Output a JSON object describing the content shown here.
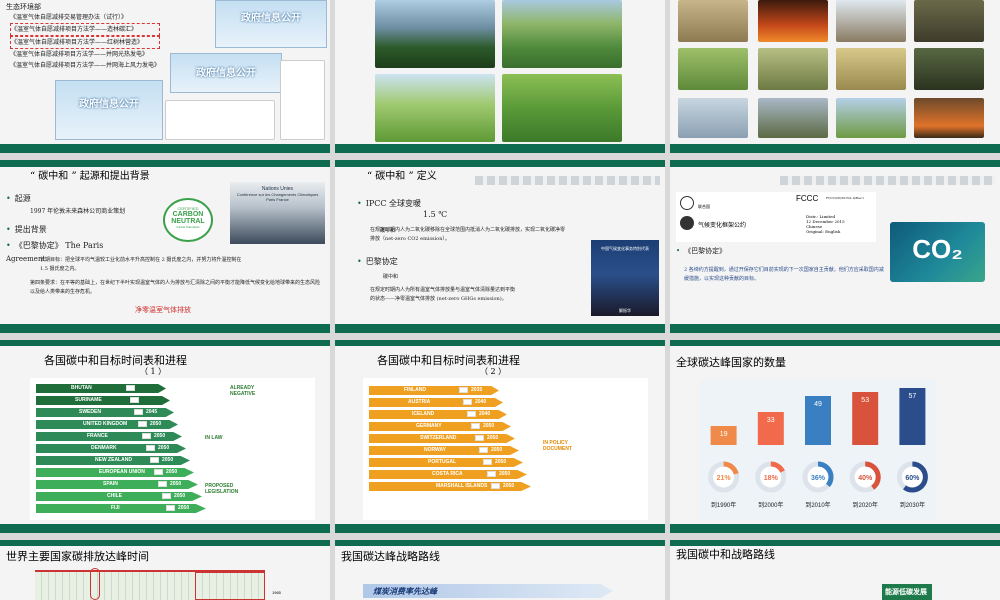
{
  "slide1": {
    "org": "生态环境部",
    "lines": [
      "《温室气体自愿减排交易管理办法（试行）》",
      "《温室气体自愿减排项目方法学——造林碳汇》",
      "《温室气体自愿减排项目方法学——红树林营造》",
      "《温室气体自愿减排项目方法学——并网光热发电》",
      "《温室气体自愿减排项目方法学——并网海上风力发电》"
    ],
    "gov_label": "政府信息公开"
  },
  "slide4": {
    "title": "“ 碳中和 ” 起源和提出背景",
    "title_tail": "景",
    "b1": "起源",
    "b1_sub": "1997 年伦敦未来森林公司商业策划",
    "b2": "提出背景",
    "b3": "《巴黎协定》 The Paris",
    "agreement": "Agreement",
    "goal1": "长期目标：把全球平均气温较工业化前水平升高控制在 2 摄氏度之内，并努力将升温控制在",
    "goal2": "1.5 摄氏度之内。",
    "art4": "第四条要求：在平等的基础上，在世纪下半叶实现温室气体的人为排放与汇清除之间的平衡才能降低气候变化给地球带来的生态风险以及给人类带来的生存危机。",
    "net_zero": "净零温室气体排放",
    "badge": [
      "CERTIFIED",
      "CARBON",
      "NEUTRAL",
      "Global Standards"
    ],
    "photo_caption": [
      "Nations Unies",
      "Conférence sur les Changements Climatiques",
      "Paris France"
    ]
  },
  "slide5": {
    "title": "“ 碳中和 ” 定义",
    "title_tail": "义",
    "ipcc": "IPCC 全球变暖",
    "temp": "1.5 ℃",
    "def_label": "碳中和",
    "def1": "在规定时期内人为二氧化碳移除在全球范围内抵消人为二氧化碳排放，实现二氧化碳净零",
    "def1b": "排放（net-zero CO2 emission）。",
    "paris": "巴黎协定",
    "def2_label": "碳中和",
    "def2": "在规定时期内人为所有温室气体排放量与温室气体清除量达到平衡",
    "def2b": "的状态——净零温室气体排放 (net-zero GHGs emission)。",
    "photo_caption": "中国气候变化事务特别代表",
    "photo_name": "解振华"
  },
  "slide6": {
    "doc_head": "FCCC",
    "doc_code": "FCCC/CP/2015/L.9/Rev.1",
    "un_label": "联合国",
    "doc_title": "气候变化框架公约",
    "meta": [
      "Distr.: Limited",
      "12 December 2015",
      "Chinese",
      "Original: English"
    ],
    "bullet": "《巴黎协定》",
    "desc1": "2 各缔约方提醒到，通过开保存它们目前实现的下一次国家自主贡献，他们方应采取国内减",
    "desc2": "缓措施，以实现这种贡献的目标。",
    "co2": "CO₂"
  },
  "slide7": {
    "title": "各国碳中和目标时间表和进程",
    "subtitle": "（ 1 ）",
    "rows": [
      {
        "name": "BHUTAN",
        "year": "",
        "color": "#1f6e3a"
      },
      {
        "name": "SURINAME",
        "year": "",
        "color": "#1f6e3a"
      },
      {
        "name": "SWEDEN",
        "year": "2045",
        "color": "#2e8b57"
      },
      {
        "name": "UNITED KINGDOM",
        "year": "2050",
        "color": "#2e8b57"
      },
      {
        "name": "FRANCE",
        "year": "2050",
        "color": "#2e8b57"
      },
      {
        "name": "DENMARK",
        "year": "2050",
        "color": "#2e8b57"
      },
      {
        "name": "NEW ZEALAND",
        "year": "2050",
        "color": "#2e8b57"
      },
      {
        "name": "EUROPEAN UNION",
        "year": "2050",
        "color": "#3fae5a"
      },
      {
        "name": "SPAIN",
        "year": "2050",
        "color": "#3fae5a"
      },
      {
        "name": "CHILE",
        "year": "2050",
        "color": "#3fae5a"
      },
      {
        "name": "FIJI",
        "year": "2050",
        "color": "#3fae5a"
      }
    ],
    "labels": [
      "ALREADY NEGATIVE",
      "IN LAW",
      "PROPOSED LEGISLATION"
    ]
  },
  "slide8": {
    "title": "各国碳中和目标时间表和进程",
    "subtitle": "（ 2 ）",
    "rows": [
      {
        "name": "FINLAND",
        "year": "2035"
      },
      {
        "name": "AUSTRIA",
        "year": "2040"
      },
      {
        "name": "ICELAND",
        "year": "2040"
      },
      {
        "name": "GERMANY",
        "year": "2050"
      },
      {
        "name": "SWITZERLAND",
        "year": "2050"
      },
      {
        "name": "NORWAY",
        "year": "2050"
      },
      {
        "name": "PORTUGAL",
        "year": "2050"
      },
      {
        "name": "COSTA RICA",
        "year": "2050"
      },
      {
        "name": "MARSHALL ISLANDS",
        "year": "2050"
      }
    ],
    "label": "IN POLICY DOCUMENT"
  },
  "slide9": {
    "title": "全球碳达峰国家的数量"
  },
  "chart_data": {
    "type": "bar",
    "categories": [
      "到1990年",
      "到2000年",
      "到2010年",
      "到2020年",
      "到2030年"
    ],
    "values": [
      19,
      33,
      49,
      53,
      57
    ],
    "percents": [
      "21%",
      "18%",
      "36%",
      "40%",
      "60%"
    ],
    "percent_values": [
      21,
      18,
      36,
      40,
      60
    ],
    "colors": [
      "#f08a4b",
      "#f06a4b",
      "#3a7fc2",
      "#d9533c",
      "#2b4d8c"
    ]
  },
  "slide10": {
    "title": "世界主要国家碳排放达峰时间",
    "year_label": "1965"
  },
  "slide11": {
    "title": "我国碳达峰战略路线",
    "banner": "煤炭消费率先达峰"
  },
  "slide12": {
    "title": "我国碳中和战略路线",
    "banner": "能源低碳发展"
  }
}
